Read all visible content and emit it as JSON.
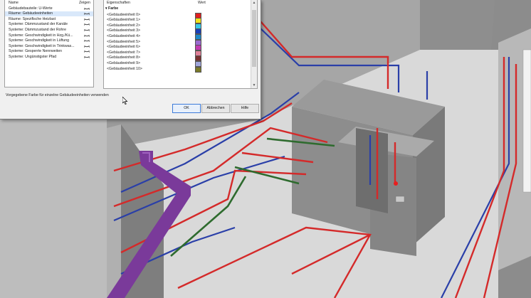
{
  "dialog": {
    "left_list": {
      "header_name": "Name",
      "header_show": "Zeigen",
      "items": [
        {
          "label": "Gebäudebauteile: U-Werte",
          "selected": false
        },
        {
          "label": "Räume: Gebäudeeinheiten",
          "selected": true
        },
        {
          "label": "Räume: Spezifische Heizlast",
          "selected": false
        },
        {
          "label": "Systeme: Dämmzustand der Kanäle",
          "selected": false
        },
        {
          "label": "Systeme: Dämmzustand der Rohre",
          "selected": false
        },
        {
          "label": "Systeme: Geschwindigkeit in Hzg./Kü...",
          "selected": false
        },
        {
          "label": "Systeme: Geschwindigkeit in Lüftung",
          "selected": false
        },
        {
          "label": "Systeme: Geschwindigkeit in Trinkwas...",
          "selected": false
        },
        {
          "label": "Systeme: Gesperrte Nennweiten",
          "selected": false
        },
        {
          "label": "Systeme: Ungünstigster Pfad",
          "selected": false
        }
      ]
    },
    "properties": {
      "header_props": "Eigenschaften",
      "header_value": "Wert",
      "group": "Farbe",
      "rows": [
        {
          "label": "<Gebäudeeinheit 0>",
          "color": "#e02020"
        },
        {
          "label": "<Gebäudeeinheit 1>",
          "color": "#f2e21a"
        },
        {
          "label": "<Gebäudeeinheit 2>",
          "color": "#38c8e8"
        },
        {
          "label": "<Gebäudeeinheit 3>",
          "color": "#1a3fb8"
        },
        {
          "label": "<Gebäudeeinheit 4>",
          "color": "#1e88c8"
        },
        {
          "label": "<Gebäudeeinheit 5>",
          "color": "#9a6ad0"
        },
        {
          "label": "<Gebäudeeinheit 6>",
          "color": "#c23ab0"
        },
        {
          "label": "<Gebäudeeinheit 7>",
          "color": "#e08098"
        },
        {
          "label": "<Gebäudeeinheit 8>",
          "color": "#7a3030"
        },
        {
          "label": "<Gebäudeeinheit 9>",
          "color": "#a0a6dc"
        },
        {
          "label": "<Gebäudeeinheit 10>",
          "color": "#7a7a28"
        }
      ]
    },
    "description": "Vorgegebene Farbe für einzelne Gebäudeeinheiten verwenden",
    "buttons": {
      "ok": "OK",
      "cancel": "Abbrechen",
      "help": "Hilfe"
    }
  },
  "colors": {
    "pipe_red": "#d42a2a",
    "pipe_blue": "#2a3fa8",
    "pipe_green": "#2e6b2e",
    "duct_purple": "#7a3a9a",
    "wall_grey": "#8a8a8a",
    "floor": "#d9d9d9"
  }
}
